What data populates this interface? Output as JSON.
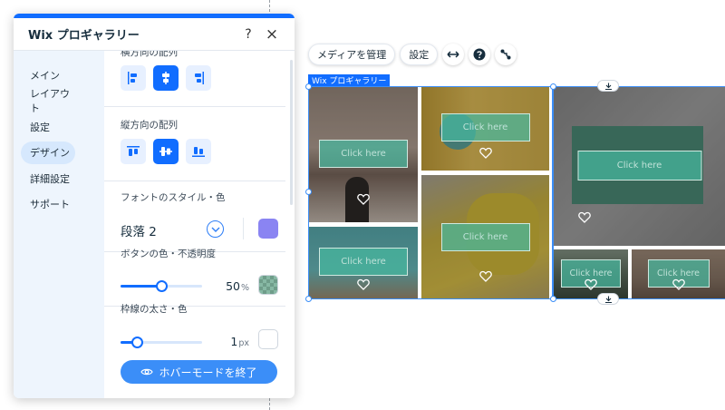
{
  "panel": {
    "title": "Wix プロギャラリー",
    "help_icon": "?",
    "close_icon": "×",
    "sidebar": [
      {
        "label": "メイン"
      },
      {
        "label": "レイアウト"
      },
      {
        "label": "設定"
      },
      {
        "label": "デザイン",
        "active": true
      },
      {
        "label": "詳細設定"
      },
      {
        "label": "サポート"
      }
    ],
    "sections": {
      "horizontal_align": {
        "title": "横方向の配列"
      },
      "vertical_align": {
        "title": "縦方向の配列"
      },
      "font": {
        "title": "フォントのスタイル・色",
        "value": "段落 2",
        "color": "#8a84f2"
      },
      "button_color": {
        "title": "ボタンの色・不透明度",
        "value": "50",
        "unit": "%",
        "percent": 50
      },
      "border": {
        "title": "枠線の太さ・色",
        "value": "1",
        "unit": "px",
        "percent": 20
      }
    },
    "exit_button": {
      "label": "ホバーモードを終了"
    }
  },
  "toolbar": {
    "manage_media": "メディアを管理",
    "settings": "設定"
  },
  "gallery": {
    "label": "Wix プロギャラリー",
    "items": [
      {
        "cta": "Click here"
      },
      {
        "cta": "Click here"
      },
      {
        "cta": "Click here"
      },
      {
        "cta": "Click here"
      },
      {
        "cta": "Click here"
      },
      {
        "cta": "Click here"
      },
      {
        "cta": "Click here"
      }
    ]
  },
  "colors": {
    "accent": "#116dff",
    "sidebar_bg": "#eef5fd"
  }
}
